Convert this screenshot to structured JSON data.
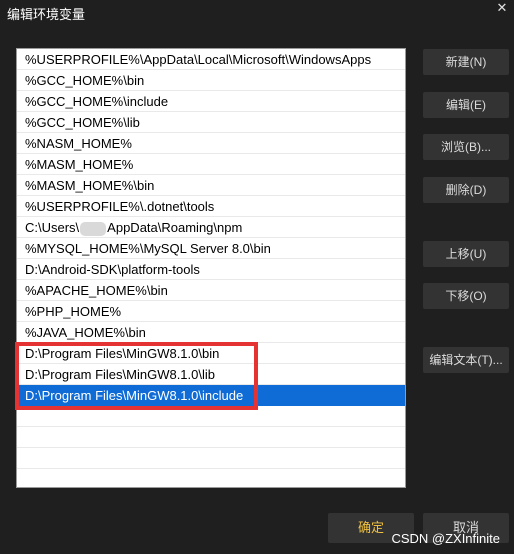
{
  "window": {
    "title": "编辑环境变量",
    "close_symbol": "✕"
  },
  "list": {
    "items": [
      "%USERPROFILE%\\AppData\\Local\\Microsoft\\WindowsApps",
      "%GCC_HOME%\\bin",
      "%GCC_HOME%\\include",
      "%GCC_HOME%\\lib",
      "%NASM_HOME%",
      "%MASM_HOME%",
      "%MASM_HOME%\\bin",
      "%USERPROFILE%\\.dotnet\\tools",
      "C:\\Users\\",
      "%MYSQL_HOME%\\MySQL Server 8.0\\bin",
      "D:\\Android-SDK\\platform-tools",
      "%APACHE_HOME%\\bin",
      "%PHP_HOME%",
      "%JAVA_HOME%\\bin",
      "D:\\Program Files\\MinGW8.1.0\\bin",
      "D:\\Program Files\\MinGW8.1.0\\lib",
      "D:\\Program Files\\MinGW8.1.0\\include"
    ],
    "row9_suffix": "AppData\\Roaming\\npm",
    "selected_index": 16,
    "selected_color": "#0f6cd6",
    "highlight_color": "#e53333"
  },
  "buttons": {
    "new": "新建(N)",
    "edit": "编辑(E)",
    "browse": "浏览(B)...",
    "delete": "删除(D)",
    "move_up": "上移(U)",
    "move_down": "下移(O)",
    "edit_text": "编辑文本(T)...",
    "ok": "确定",
    "cancel": "取消"
  },
  "watermark": "CSDN @ZXInfinite"
}
